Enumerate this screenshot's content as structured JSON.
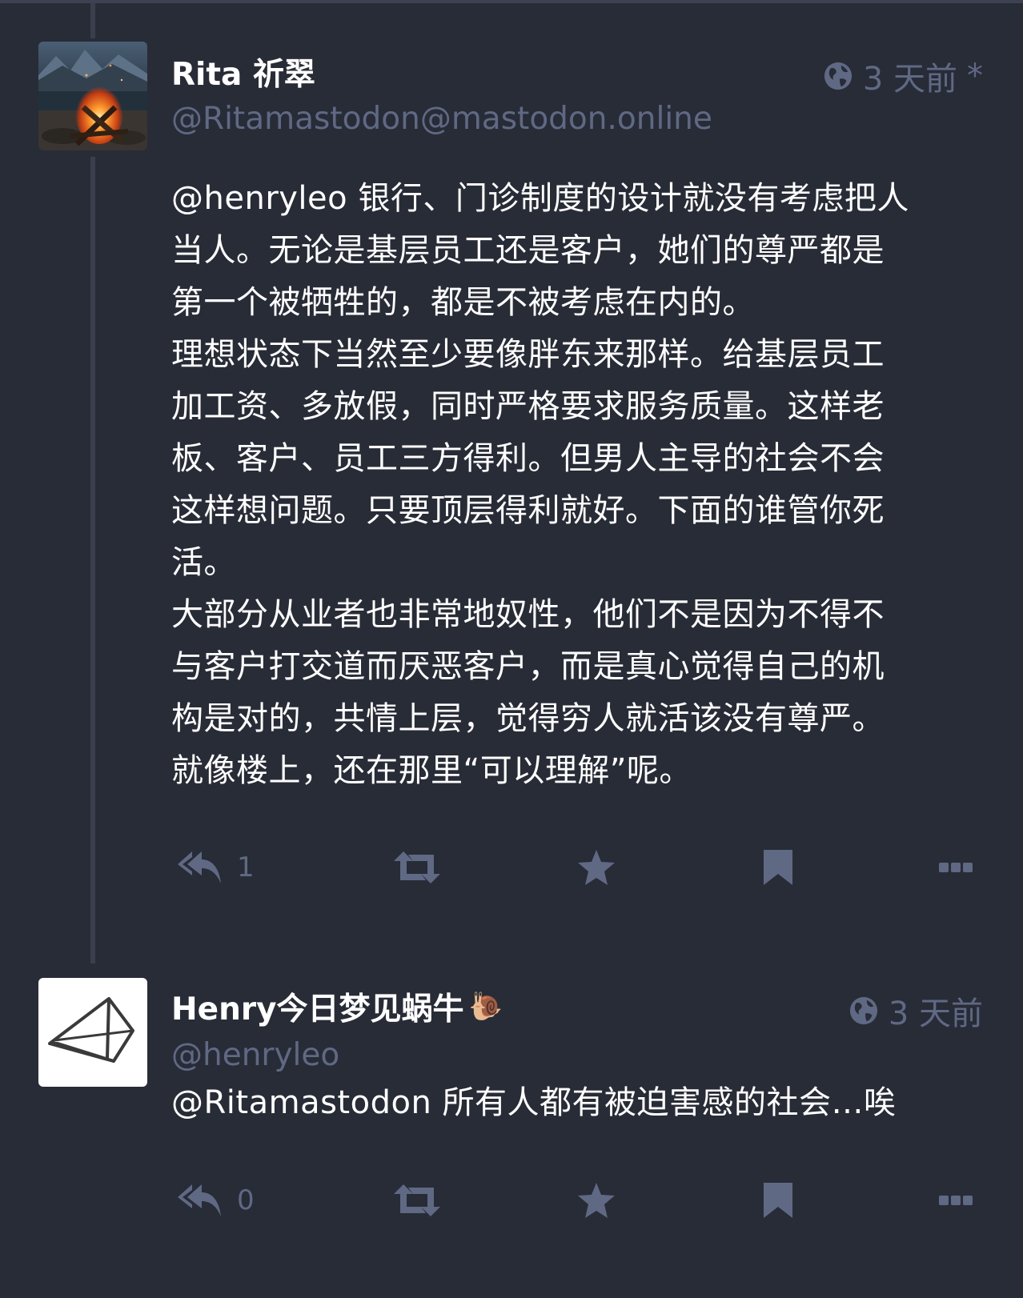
{
  "statuses": [
    {
      "display_name": "Rita 祈翠",
      "handle": "@Ritamastodon@mastodon.online",
      "visibility_icon": "globe-icon",
      "time": "3 天前",
      "edited_mark": "*",
      "content": "@henryleo 银行、门诊制度的设计就没有考虑把人\n当人。无论是基层员工还是客户，她们的尊严都是\n第一个被牺牲的，都是不被考虑在内的。\n理想状态下当然至少要像胖东来那样。给基层员工\n加工资、多放假，同时严格要求服务质量。这样老\n板、客户、员工三方得利。但男人主导的社会不会\n这样想问题。只要顶层得利就好。下面的谁管你死\n活。\n大部分从业者也非常地奴性，他们不是因为不得不\n与客户打交道而厌恶客户，而是真心觉得自己的机\n构是对的，共情上层，觉得穷人就活该没有尊严。\n就像楼上，还在那里“可以理解”呢。",
      "reply_count": "1"
    },
    {
      "display_name": "Henry今日梦见蜗牛",
      "name_emoji": "🐌",
      "handle": "@henryleo",
      "visibility_icon": "globe-icon",
      "time": "3 天前",
      "content": "@Ritamastodon 所有人都有被迫害感的社会…唉",
      "reply_count": "0"
    }
  ],
  "colors": {
    "background": "#282c37",
    "muted": "#606984",
    "text": "#ffffff",
    "thread_line": "#3a3f4e"
  }
}
